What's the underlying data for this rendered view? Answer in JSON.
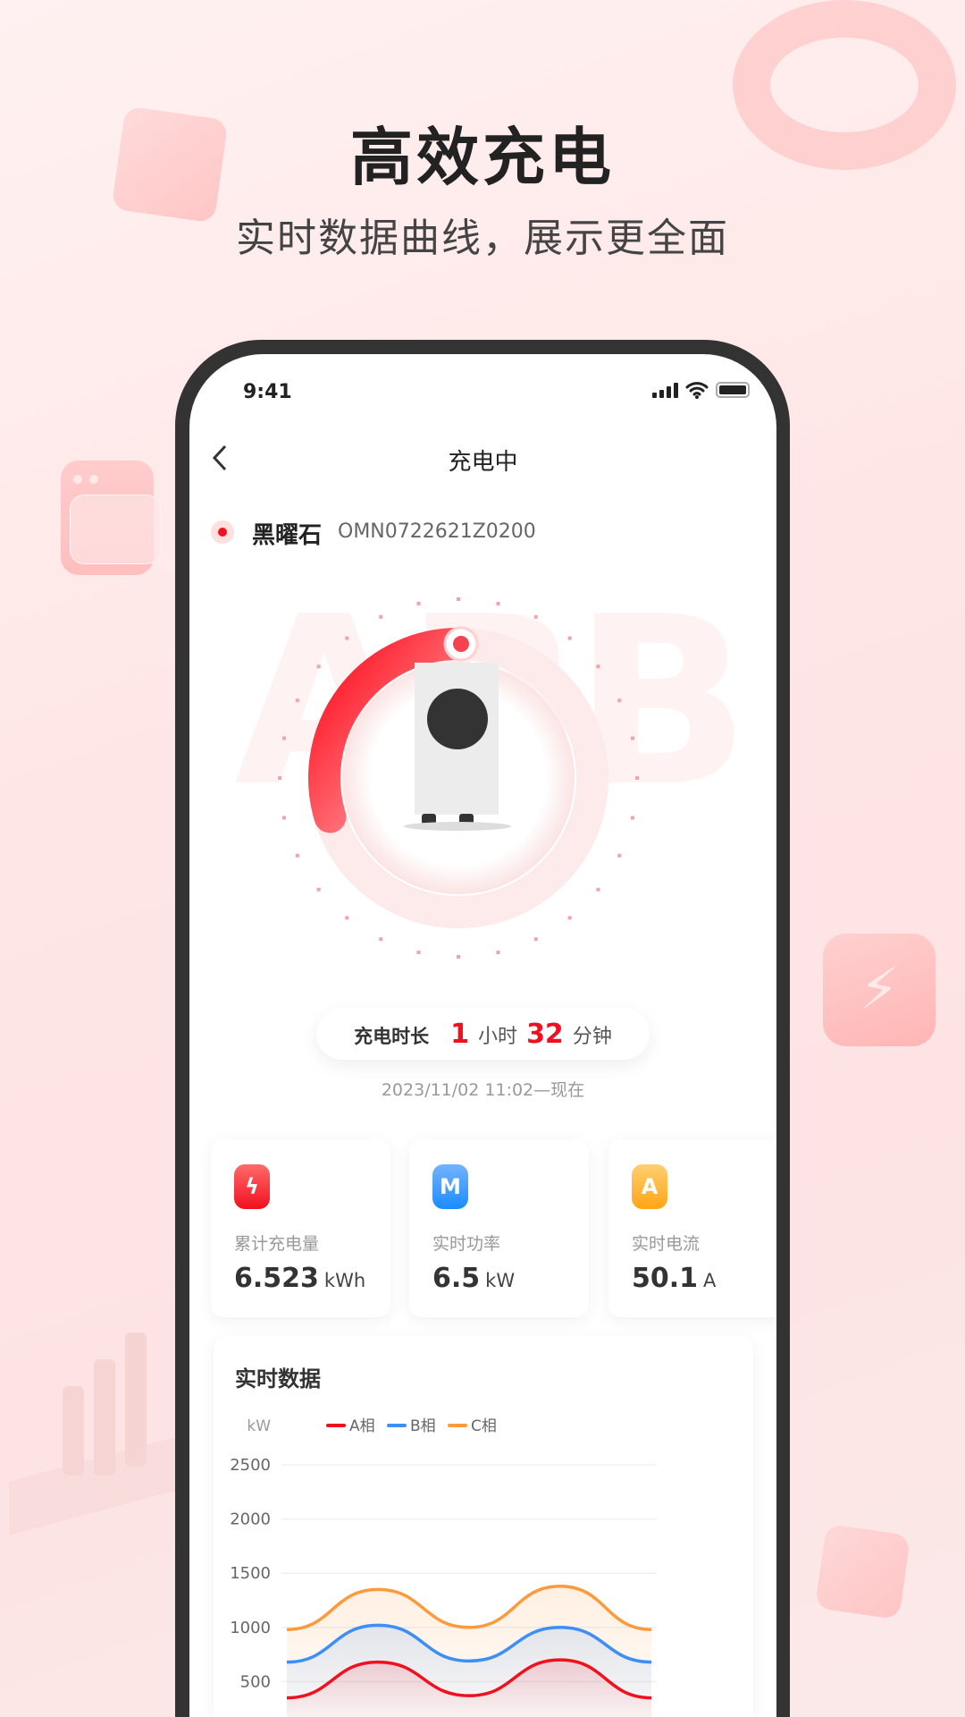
{
  "promo": {
    "headline": "高效充电",
    "subline": "实时数据曲线，展示更全面"
  },
  "status_bar": {
    "time": "9:41"
  },
  "nav": {
    "title": "充电中",
    "back_icon": "chevron-left-icon"
  },
  "device": {
    "name": "黑曜石",
    "id": "OMN0722621Z0200",
    "status_color": "#f0101e"
  },
  "charging": {
    "progress_percent": 30,
    "watermark": "ABB"
  },
  "duration": {
    "label": "充电时长",
    "hours": "1",
    "hours_unit": "小时",
    "minutes": "32",
    "minutes_unit": "分钟",
    "since": "2023/11/02 11:02—现在"
  },
  "stats": [
    {
      "label": "累计充电量",
      "value": "6.523",
      "unit": "kWh",
      "icon": "lightning-icon",
      "color": "#f0101e"
    },
    {
      "label": "实时功率",
      "value": "6.5",
      "unit": "kW",
      "icon": "power-wave-icon",
      "color": "#1a8cff"
    },
    {
      "label": "实时电流",
      "value": "50.1",
      "unit": "A",
      "icon": "ampere-icon",
      "color": "#ffa516"
    }
  ],
  "chart_data": {
    "type": "area",
    "title": "实时数据",
    "ylabel": "kW",
    "ylim": [
      0,
      2500
    ],
    "yticks": [
      "2500",
      "2000",
      "1500",
      "1000",
      "500"
    ],
    "grid": true,
    "legend_placement": "top",
    "x": [
      0,
      1,
      2,
      3,
      4
    ],
    "series": [
      {
        "name": "A相",
        "color": "#f0101e",
        "values": [
          350,
          680,
          370,
          700,
          350
        ]
      },
      {
        "name": "B相",
        "color": "#3d8ff5",
        "values": [
          680,
          1020,
          690,
          1000,
          680
        ]
      },
      {
        "name": "C相",
        "color": "#ff9a3c",
        "values": [
          980,
          1350,
          1000,
          1380,
          980
        ]
      }
    ]
  }
}
